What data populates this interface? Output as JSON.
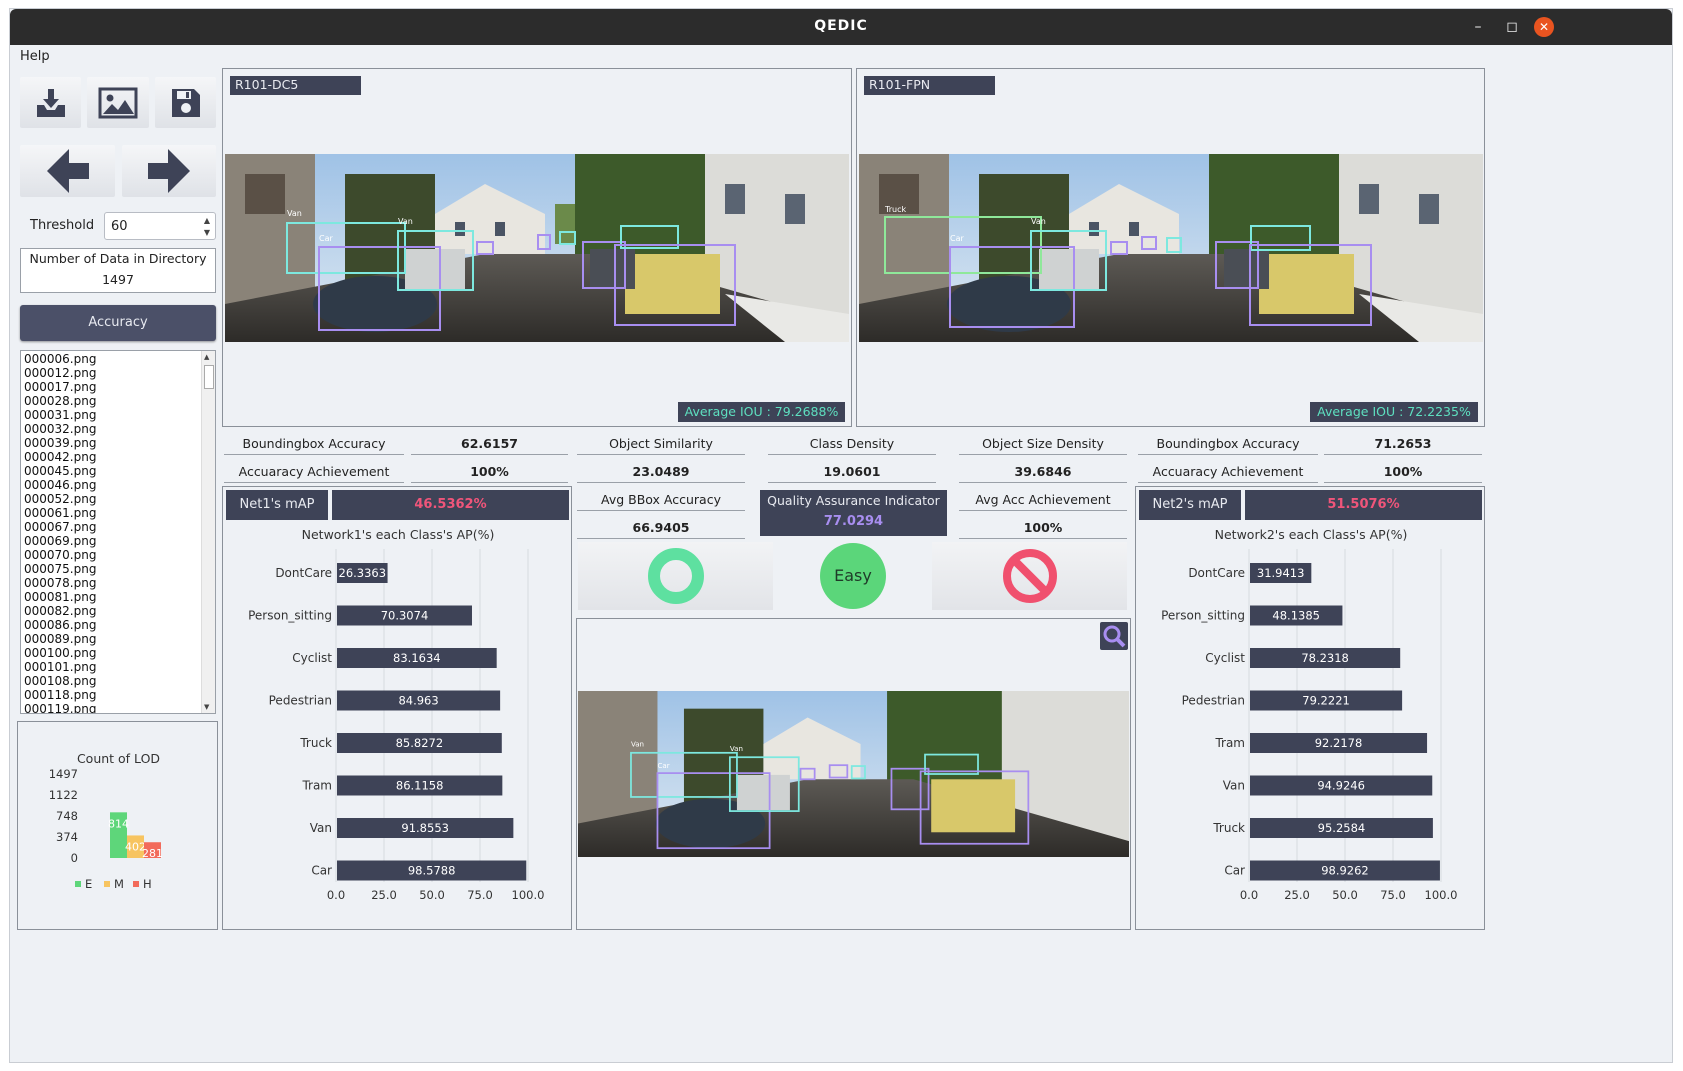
{
  "window": {
    "title": "QEDIC",
    "minimize": "–",
    "maximize": "◻",
    "close": "✕"
  },
  "menu": {
    "help": "Help"
  },
  "toolbar": {
    "icons": [
      "download-icon",
      "image-icon",
      "save-icon",
      "arrow-left-icon",
      "arrow-right-icon"
    ]
  },
  "threshold": {
    "label": "Threshold",
    "value": "60"
  },
  "data_count": {
    "label": "Number of Data in Directory",
    "value": "1497"
  },
  "accuracy_button": "Accuracy",
  "files": [
    "000006.png",
    "000012.png",
    "000017.png",
    "000028.png",
    "000031.png",
    "000032.png",
    "000039.png",
    "000042.png",
    "000045.png",
    "000046.png",
    "000052.png",
    "000061.png",
    "000067.png",
    "000069.png",
    "000070.png",
    "000075.png",
    "000078.png",
    "000081.png",
    "000082.png",
    "000086.png",
    "000089.png",
    "000100.png",
    "000101.png",
    "000108.png",
    "000118.png",
    "000119.png"
  ],
  "lod_chart": {
    "title": "Count of LOD",
    "yticks": [
      "1497",
      "1122",
      "748",
      "374",
      "0"
    ],
    "legend": [
      "E",
      "M",
      "H"
    ]
  },
  "net1": {
    "model": "R101-DC5",
    "avg_iou": "Average IOU : 79.2688%"
  },
  "net2": {
    "model": "R101-FPN",
    "avg_iou": "Average IOU : 72.2235%"
  },
  "metrics": {
    "bbox_acc_label": "Boundingbox Accuracy",
    "bbox_acc_1": "62.6157",
    "bbox_acc_2": "71.2653",
    "acc_ach_label": "Accuaracy Achievement",
    "acc_ach_1": "100%",
    "acc_ach_2": "100%",
    "obj_sim_label": "Object Similarity",
    "obj_sim": "23.0489",
    "class_density_label": "Class Density",
    "class_density": "19.0601",
    "obj_size_label": "Object Size Density",
    "obj_size": "39.6846",
    "avg_bbox_label": "Avg BBox Accuracy",
    "avg_bbox": "66.9405",
    "qai_label": "Quality Assurance Indicator",
    "qai": "77.0294",
    "avg_ach_label": "Avg Acc Achievement",
    "avg_ach": "100%",
    "easy": "Easy"
  },
  "map": {
    "net1_label": "Net1's mAP",
    "net1_value": "46.5362%",
    "net2_label": "Net2's mAP",
    "net2_value": "51.5076%"
  },
  "colors": {
    "bar_dark": "#3e4357",
    "easy_green": "#5bd67a",
    "ok_teal": "#5ee0a0",
    "stop_red": "#f0506e",
    "bar_e": "#5ed67a",
    "bar_m": "#f7c460",
    "bar_h": "#f26b5b"
  },
  "chart_data": [
    {
      "type": "bar",
      "title": "Count of LOD",
      "categories": [
        "E",
        "M",
        "H"
      ],
      "values": [
        814,
        402,
        281
      ],
      "ylim": [
        0,
        1497
      ]
    },
    {
      "type": "bar",
      "orientation": "horizontal",
      "title": "Network1's each Class's AP(%)",
      "categories": [
        "DontCare",
        "Person_sitting",
        "Cyclist",
        "Pedestrian",
        "Truck",
        "Tram",
        "Van",
        "Car"
      ],
      "values": [
        26.3363,
        70.3074,
        83.1634,
        84.963,
        85.8272,
        86.1158,
        91.8553,
        98.5788
      ],
      "xticks": [
        "0.0",
        "25.0",
        "50.0",
        "75.0",
        "100.0"
      ],
      "xlim": [
        0,
        100
      ]
    },
    {
      "type": "bar",
      "orientation": "horizontal",
      "title": "Network2's each Class's AP(%)",
      "categories": [
        "DontCare",
        "Person_sitting",
        "Cyclist",
        "Pedestrian",
        "Tram",
        "Van",
        "Truck",
        "Car"
      ],
      "values": [
        31.9413,
        48.1385,
        78.2318,
        79.2221,
        92.2178,
        94.9246,
        95.2584,
        98.9262
      ],
      "xticks": [
        "0.0",
        "25.0",
        "50.0",
        "75.0",
        "100.0"
      ],
      "xlim": [
        0,
        100
      ]
    }
  ]
}
